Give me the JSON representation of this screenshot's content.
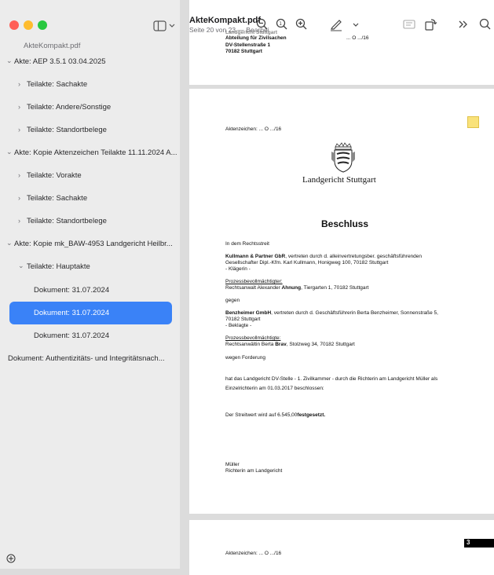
{
  "window": {
    "app_title": "AkteKompakt.pdf",
    "subtitle": "Seite 20 von 23 — Bearbei"
  },
  "sidebar": {
    "doc_title": "AkteKompakt.pdf",
    "items": [
      {
        "chevron": "v",
        "label": "Akte: AEP 3.5.1 03.04.2025"
      },
      {
        "chevron": ">",
        "label": "Teilakte: Sachakte"
      },
      {
        "chevron": ">",
        "label": "Teilakte: Andere/Sonstige"
      },
      {
        "chevron": ">",
        "label": "Teilakte: Standortbelege"
      },
      {
        "chevron": "v",
        "label": "Akte: Kopie Aktenzeichen Teilakte 11.11.2024 A..."
      },
      {
        "chevron": ">",
        "label": "Teilakte: Vorakte"
      },
      {
        "chevron": ">",
        "label": "Teilakte: Sachakte"
      },
      {
        "chevron": ">",
        "label": "Teilakte: Standortbelege"
      },
      {
        "chevron": "v",
        "label": "Akte: Kopie mk_BAW-4953 Landgericht Heilbr..."
      },
      {
        "chevron": "v",
        "label": "Teilakte: Hauptakte"
      },
      {
        "chevron": "",
        "label": "Dokument: 31.07.2024"
      },
      {
        "chevron": "",
        "label": "Dokument: 31.07.2024",
        "selected": true
      },
      {
        "chevron": "",
        "label": "Dokument: 31.07.2024"
      },
      {
        "chevron": "",
        "label": "Dokument: Authentizitäts- und Integritätsnach..."
      }
    ]
  },
  "toolbar": {
    "icons": [
      "zoom-out-icon",
      "actual-size-icon",
      "zoom-in-icon",
      "markup-pen-icon",
      "markup-menu-chevron-icon",
      "highlight-icon",
      "rotate-icon",
      "more-icon",
      "search-icon"
    ]
  },
  "page1": {
    "line1": "Landgericht Stuttgart",
    "line2": "Abteilung für Zivilsachen",
    "line3": "DV-Stellenstraße 1",
    "line4": "70182 Stuttgart",
    "ref": "... O .../16"
  },
  "page2": {
    "aktenzeichen": "Aktenzeichen: ... O .../16",
    "court": "Landgericht Stuttgart",
    "heading": "Beschluss",
    "intro": "In dem Rechtsstreit",
    "party1_name": "Kullmann & Partner GbR",
    "party1_rest": ", vertreten durch d. alleinvertretungsber. geschäftsführenden",
    "party1_line2": "Gesellschafter Dipl.-Kfm. Karl Kullmann, Honigweg 100, 70182 Stuttgart",
    "party1_role": "- Klägerin -",
    "counsel1_label": "Prozessbevollmächtigter:",
    "counsel1_pre": "Rechtsanwalt Alexander ",
    "counsel1_name": "Ahnung",
    "counsel1_post": ", Tiergarten 1, 70182 Stuttgart",
    "gegen": "gegen",
    "party2_name": "Benzheimer GmbH",
    "party2_rest": ", vertreten durch d. Geschäftsführerin Berta Benzheimer, Sonnenstraße 5,",
    "party2_line2": "70182 Stuttgart",
    "party2_role": "- Beklagte -",
    "counsel2_label": "Prozessbevollmächtigte:",
    "counsel2_pre": "Rechtsanwältin Berta ",
    "counsel2_name": "Brav",
    "counsel2_post": ", Stolzweg 34, 70182 Stuttgart",
    "wegen": "wegen Forderung",
    "body1": "hat das Landgericht DV-Stelle - 1. Zivilkammer - durch die Richterin am Landgericht Müller als",
    "body2": "Einzelrichterin am 01.03.2017 beschlossen:",
    "ruling_pre": "Der Streitwert wird auf 6.545,00",
    "ruling_post": "festgesetzt.",
    "sign_name": "Müller",
    "sign_title": "Richterin am Landgericht"
  },
  "page3": {
    "aktenzeichen": "Aktenzeichen: ... O .../16",
    "page_badge": "3"
  }
}
